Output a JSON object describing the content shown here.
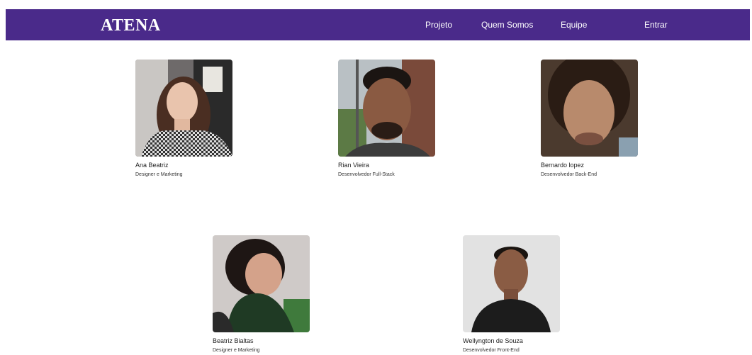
{
  "navbar": {
    "logo": "ATENA",
    "links": [
      "Projeto",
      "Quem Somos",
      "Equipe",
      "Entrar"
    ],
    "color": "#4a2a8a"
  },
  "team": [
    {
      "name": "Ana Beatriz",
      "role": "Designer e Marketing"
    },
    {
      "name": "Rian Vieira",
      "role": "Desenvolvedor Full-Stack"
    },
    {
      "name": "Bernardo lopez",
      "role": "Desenvolvedor Back-End"
    },
    {
      "name": "Beatriz Bialtas",
      "role": "Designer e Marketing"
    },
    {
      "name": "Wellyngton de Souza",
      "role": "Desenvolvedor Front-End"
    }
  ]
}
